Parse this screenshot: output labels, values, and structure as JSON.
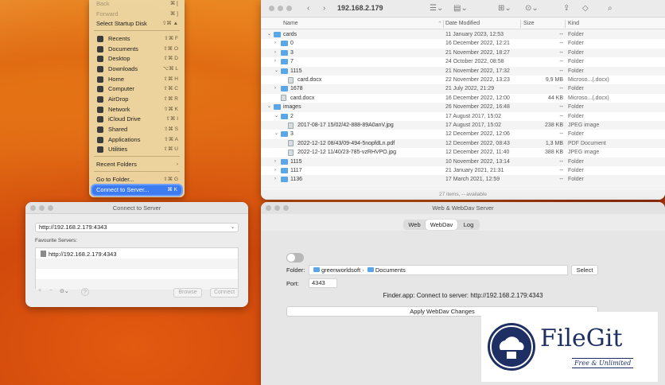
{
  "go_menu": {
    "items_top": [
      {
        "label": "Back",
        "shortcut": "⌘ [",
        "dim": true
      },
      {
        "label": "Forward",
        "shortcut": "⌘ ]",
        "dim": true
      },
      {
        "label": "Select Startup Disk",
        "shortcut": "⇧⌘ ▲"
      }
    ],
    "items_places": [
      {
        "label": "Recents",
        "shortcut": "⇧⌘ F",
        "icon": "clock-icon"
      },
      {
        "label": "Documents",
        "shortcut": "⇧⌘ O",
        "icon": "document-icon"
      },
      {
        "label": "Desktop",
        "shortcut": "⇧⌘ D",
        "icon": "desktop-icon"
      },
      {
        "label": "Downloads",
        "shortcut": "⌥⌘ L",
        "icon": "download-icon"
      },
      {
        "label": "Home",
        "shortcut": "⇧⌘ H",
        "icon": "home-icon"
      },
      {
        "label": "Computer",
        "shortcut": "⇧⌘ C",
        "icon": "computer-icon"
      },
      {
        "label": "AirDrop",
        "shortcut": "⇧⌘ R",
        "icon": "airdrop-icon"
      },
      {
        "label": "Network",
        "shortcut": "⇧⌘ K",
        "icon": "network-icon"
      },
      {
        "label": "iCloud Drive",
        "shortcut": "⇧⌘ I",
        "icon": "cloud-icon"
      },
      {
        "label": "Shared",
        "shortcut": "⇧⌘ S",
        "icon": "shared-icon"
      },
      {
        "label": "Applications",
        "shortcut": "⇧⌘ A",
        "icon": "applications-icon"
      },
      {
        "label": "Utilities",
        "shortcut": "⇧⌘ U",
        "icon": "utilities-icon"
      }
    ],
    "recent_folders": {
      "label": "Recent Folders",
      "shortcut": "›"
    },
    "go_to_folder": {
      "label": "Go to Folder...",
      "shortcut": "⇧⌘ G"
    },
    "connect_to_server": {
      "label": "Connect to Server...",
      "shortcut": "⌘ K"
    }
  },
  "finder": {
    "title": "192.168.2.179",
    "columns": {
      "name": "Name",
      "date": "Date Modified",
      "size": "Size",
      "kind": "Kind"
    },
    "rows": [
      {
        "indent": 0,
        "arrow": "⌄",
        "type": "folder",
        "name": "cards",
        "date": "11 January 2023, 12:53",
        "size": "--",
        "kind": "Folder"
      },
      {
        "indent": 1,
        "arrow": "›",
        "type": "folder",
        "name": "0",
        "date": "16 December 2022, 12:21",
        "size": "--",
        "kind": "Folder"
      },
      {
        "indent": 1,
        "arrow": "›",
        "type": "folder",
        "name": "3",
        "date": "21 November 2022, 18:27",
        "size": "--",
        "kind": "Folder"
      },
      {
        "indent": 1,
        "arrow": "›",
        "type": "folder",
        "name": "7",
        "date": "24 October 2022, 08:58",
        "size": "--",
        "kind": "Folder"
      },
      {
        "indent": 1,
        "arrow": "⌄",
        "type": "folder",
        "name": "1115",
        "date": "21 November 2022, 17:32",
        "size": "--",
        "kind": "Folder"
      },
      {
        "indent": 2,
        "arrow": "",
        "type": "doc",
        "name": "card.docx",
        "date": "22 November 2022, 13:23",
        "size": "9,9 MB",
        "kind": "Microso...(.docx)"
      },
      {
        "indent": 1,
        "arrow": "›",
        "type": "folder",
        "name": "1678",
        "date": "21 July 2022, 21:29",
        "size": "--",
        "kind": "Folder"
      },
      {
        "indent": 1,
        "arrow": "",
        "type": "doc",
        "name": "card.docx",
        "date": "16 December 2022, 12:00",
        "size": "44 KB",
        "kind": "Microso...(.docx)"
      },
      {
        "indent": 0,
        "arrow": "⌄",
        "type": "folder",
        "name": "images",
        "date": "26 November 2022, 16:48",
        "size": "--",
        "kind": "Folder"
      },
      {
        "indent": 1,
        "arrow": "⌄",
        "type": "folder",
        "name": "2",
        "date": "17 August 2017, 15:02",
        "size": "--",
        "kind": "Folder"
      },
      {
        "indent": 2,
        "arrow": "",
        "type": "doc",
        "name": "2017-08-17 15/02/42-888-89A0anV.jpg",
        "date": "17 August 2017, 15:02",
        "size": "238 KB",
        "kind": "JPEG image"
      },
      {
        "indent": 1,
        "arrow": "⌄",
        "type": "folder",
        "name": "3",
        "date": "12 December 2022, 12:06",
        "size": "--",
        "kind": "Folder"
      },
      {
        "indent": 2,
        "arrow": "",
        "type": "doc",
        "name": "2022-12-12 08/43/09-494-5nopfdLn.pdf",
        "date": "12 December 2022, 08:43",
        "size": "1,3 MB",
        "kind": "PDF Document"
      },
      {
        "indent": 2,
        "arrow": "",
        "type": "doc",
        "name": "2022-12-12 11/40/23-785-vzRHVPO.jpg",
        "date": "12 December 2022, 11:40",
        "size": "388 KB",
        "kind": "JPEG image"
      },
      {
        "indent": 1,
        "arrow": "›",
        "type": "folder",
        "name": "1115",
        "date": "10 November 2022, 13:14",
        "size": "--",
        "kind": "Folder"
      },
      {
        "indent": 1,
        "arrow": "›",
        "type": "folder",
        "name": "1117",
        "date": "21 January 2021, 21:31",
        "size": "--",
        "kind": "Folder"
      },
      {
        "indent": 1,
        "arrow": "›",
        "type": "folder",
        "name": "1136",
        "date": "17 March 2021, 12:59",
        "size": "--",
        "kind": "Folder"
      }
    ],
    "status": "27 items, -- available"
  },
  "connect": {
    "title": "Connect to Server",
    "server_address": "http://192.168.2.179:4343",
    "favourites_label": "Favourite Servers:",
    "favourite_item": "http://192.168.2.179:4343",
    "add": "+",
    "remove": "−",
    "more": "⊙⌄",
    "help": "?",
    "browse": "Browse",
    "connect": "Connect"
  },
  "webdav": {
    "title": "Web & WebDav Server",
    "tabs": [
      "Web",
      "WebDav",
      "Log"
    ],
    "selected_tab": "WebDav",
    "folder_label": "Folder:",
    "folder_path_1": "greenworldsoft",
    "folder_path_2": "Documents",
    "select": "Select",
    "port_label": "Port:",
    "port": "4343",
    "status": "Finder.app: Connect to server: http://192.168.2.179:4343",
    "apply": "Apply WebDav Changes"
  },
  "watermark": {
    "name": "FileGit",
    "tagline": "Free & Unlimited"
  }
}
